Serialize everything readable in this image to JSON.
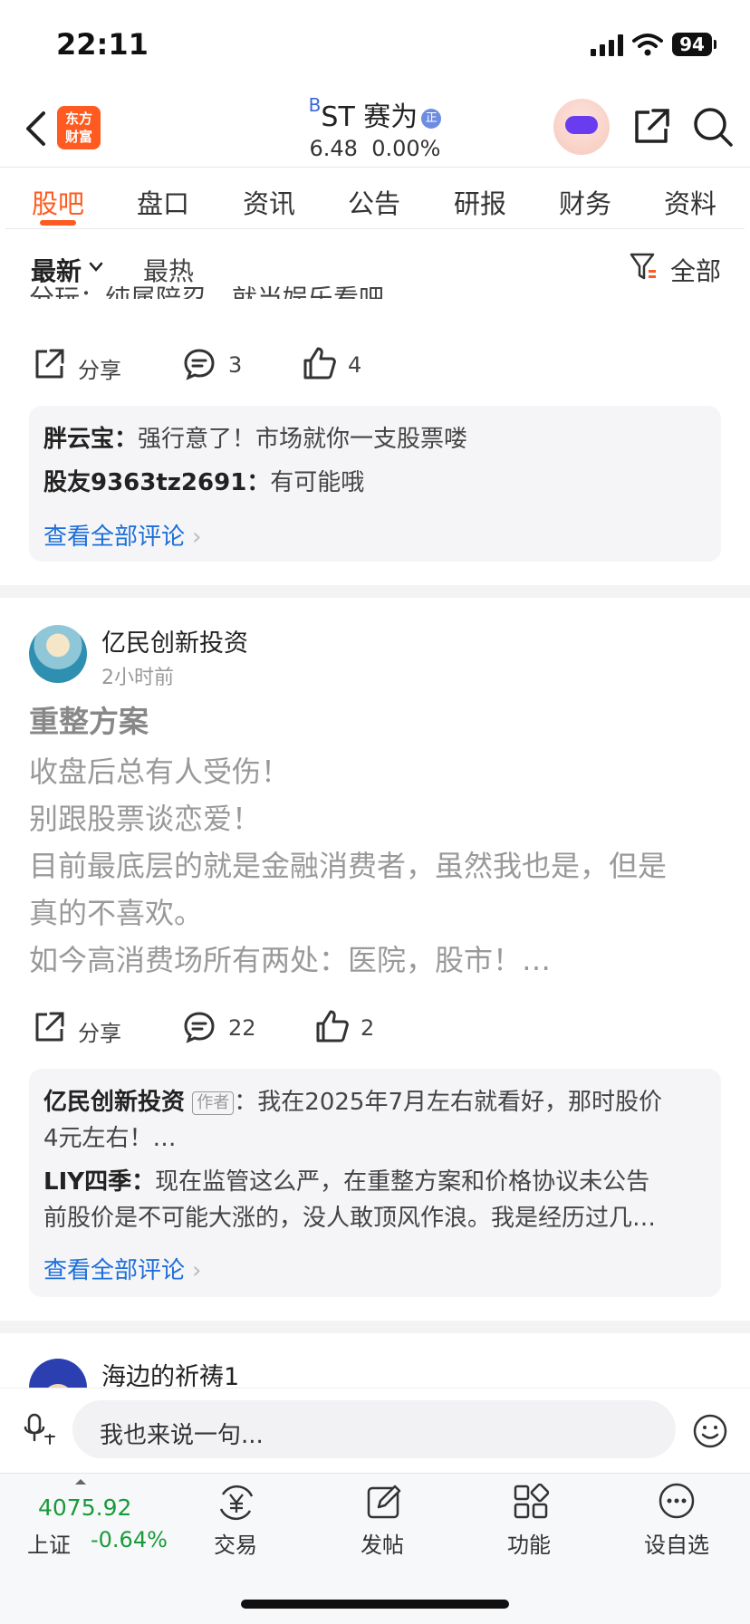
{
  "status": {
    "time": "22:11",
    "battery": "94"
  },
  "header": {
    "logo_line1": "东方",
    "logo_line2": "财富",
    "stock_prefix": "B",
    "stock_name": "ST 赛为",
    "badge": "正",
    "price": "6.48",
    "change": "0.00%"
  },
  "tabs": [
    "股吧",
    "盘口",
    "资讯",
    "公告",
    "研报",
    "财务",
    "资料"
  ],
  "sort": {
    "latest": "最新",
    "hot": "最热",
    "filter": "全部"
  },
  "post1": {
    "cut_text": "分玩：纯属陪忍，就当娱乐看吧",
    "share": "分享",
    "comments": "3",
    "likes": "4",
    "replies": [
      {
        "user": "胖云宝：",
        "text": "强行意了！市场就你一支股票喽"
      },
      {
        "user": "股友9363tz2691：",
        "text": "有可能哦"
      }
    ],
    "view_all": "查看全部评论"
  },
  "post2": {
    "author": "亿民创新投资",
    "time": "2小时前",
    "title": "重整方案",
    "body": [
      "收盘后总有人受伤！",
      "别跟股票谈恋爱！",
      "目前最底层的就是金融消费者，虽然我也是，但是",
      "真的不喜欢。",
      "如今高消费场所有两处：医院，股市！…"
    ],
    "share": "分享",
    "comments": "22",
    "likes": "2",
    "reply1_user": "亿民创新投资",
    "reply1_tag": "作者",
    "reply1_text": "：我在2025年7月左右就看好，那时股价",
    "reply1_text2": "4元左右！…",
    "reply2_user": "LIY四季：",
    "reply2_text": "现在监管这么严，在重整方案和价格协议未公告",
    "reply2_text2": "前股价是不可能大涨的，没人敢顶风作浪。我是经历过几…",
    "view_all": "查看全部评论"
  },
  "post3": {
    "author": "海边的祈祷1"
  },
  "input": {
    "placeholder": "我也来说一句..."
  },
  "bottom": {
    "index_value": "4075.92",
    "index_name": "上证",
    "index_change": "-0.64%",
    "trade": "交易",
    "post": "发帖",
    "func": "功能",
    "watch": "设自选"
  },
  "colors": {
    "accent": "#ff5a1f",
    "link": "#1e6fd9",
    "down": "#1a9a3a"
  }
}
